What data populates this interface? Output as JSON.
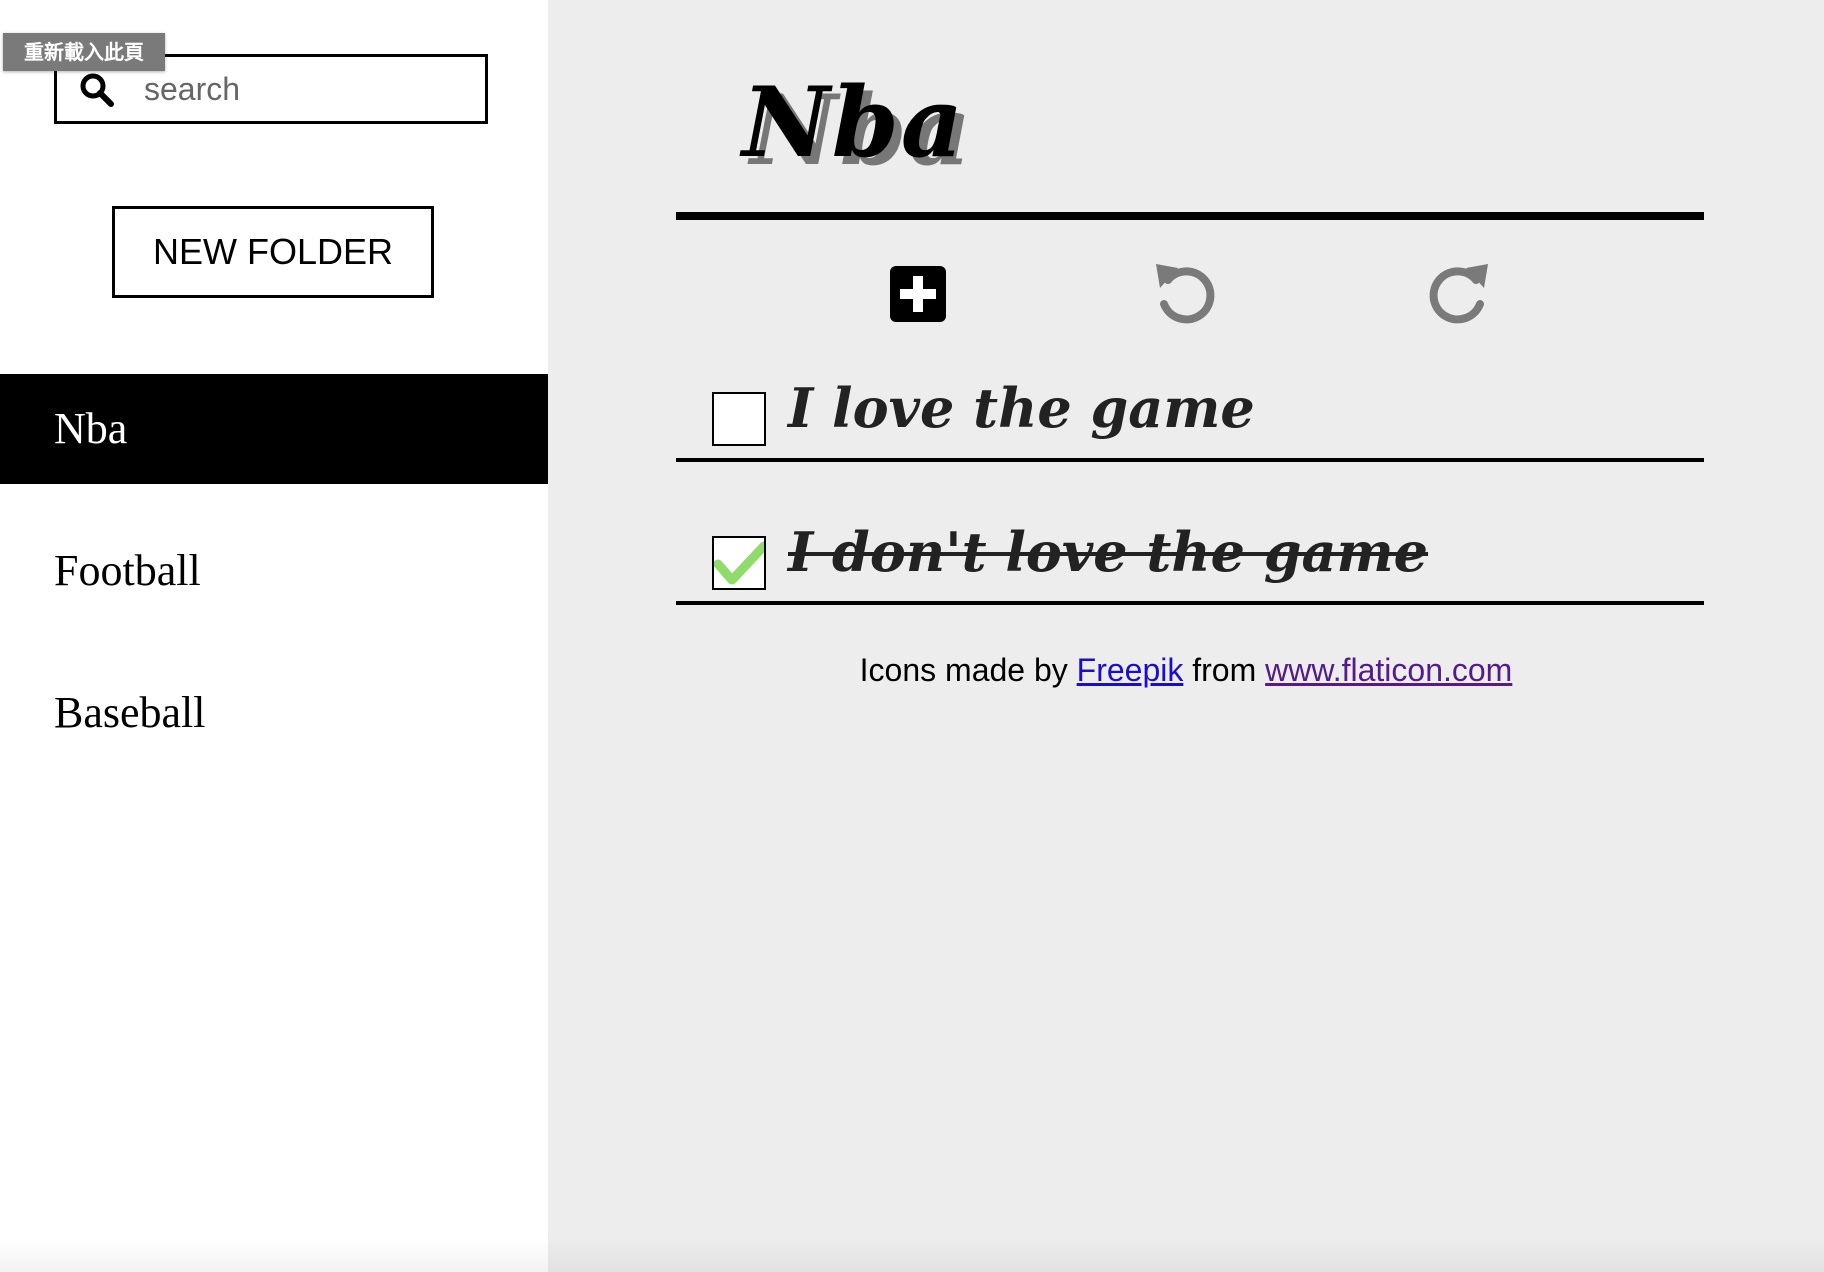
{
  "browser_overlay": {
    "reload_label": "重新載入此頁"
  },
  "sidebar": {
    "search": {
      "placeholder": "search",
      "value": "",
      "icon": "search-icon"
    },
    "new_folder_label": "NEW FOLDER",
    "folders": [
      {
        "label": "Nba",
        "active": true
      },
      {
        "label": "Football",
        "active": false
      },
      {
        "label": "Baseball",
        "active": false
      }
    ]
  },
  "main": {
    "title": "Nba",
    "toolbar": {
      "add_icon": "plus-square-icon",
      "undo_icon": "undo-icon",
      "redo_icon": "redo-icon"
    },
    "todos": [
      {
        "text": "I love the game",
        "checked": false
      },
      {
        "text": "I don't love the game",
        "checked": true
      }
    ],
    "credits": {
      "prefix": "Icons made by",
      "author_link": "Freepik",
      "middle": "from",
      "site_link": "www.flaticon.com"
    }
  },
  "colors": {
    "sidebar_bg": "#ffffff",
    "main_bg": "#ededed",
    "active_item_bg": "#000000",
    "check_green": "#8fdc6a",
    "icon_gray": "#7a7a7a"
  }
}
